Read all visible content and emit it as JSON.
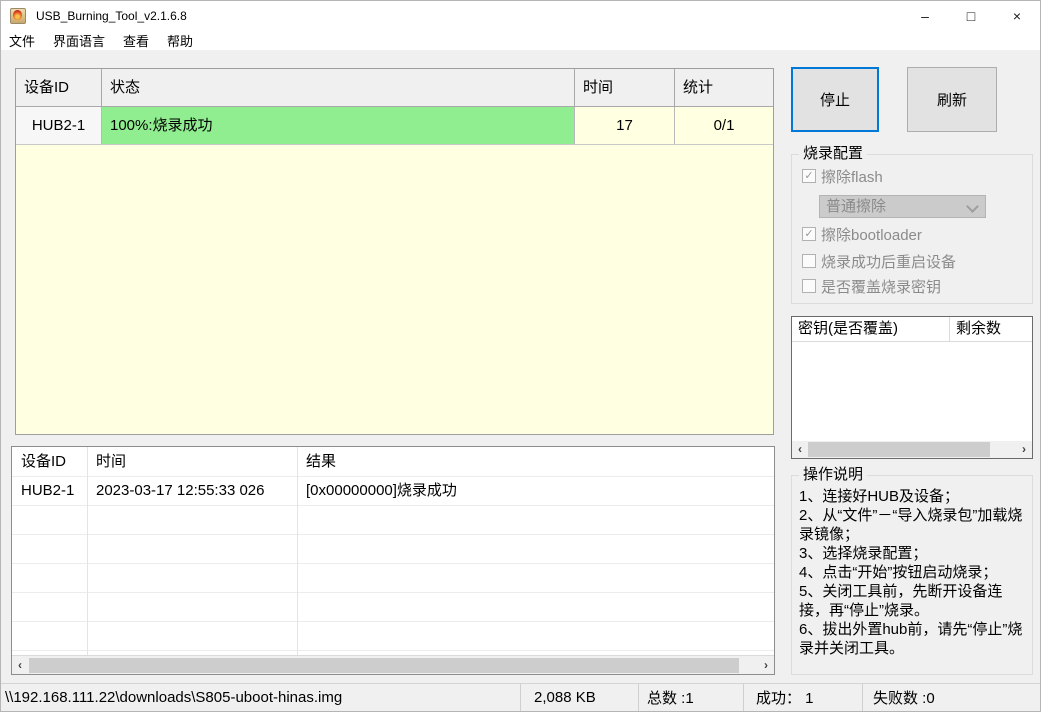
{
  "window": {
    "title": "USB_Burning_Tool_v2.1.6.8"
  },
  "icons": {
    "minimize": "–",
    "maximize": "□",
    "close": "×",
    "check": "✓",
    "scroll_left": "‹",
    "scroll_right": "›"
  },
  "menu": {
    "items": [
      "文件",
      "界面语言",
      "查看",
      "帮助"
    ]
  },
  "device_table": {
    "headers": [
      "设备ID",
      "状态",
      "时间",
      "统计"
    ],
    "row": {
      "id": "HUB2-1",
      "status": "100%:烧录成功",
      "time": "17",
      "stat": "0/1"
    }
  },
  "actions": {
    "stop": "停止",
    "refresh": "刷新"
  },
  "burn_config": {
    "title": "烧录配置",
    "erase_flash": "擦除flash",
    "erase_flash_checked": true,
    "erase_mode": "普通擦除",
    "erase_bootloader": "擦除bootloader",
    "erase_bootloader_checked": true,
    "reboot_after": "烧录成功后重启设备",
    "reboot_after_checked": false,
    "overwrite_key": "是否覆盖烧录密钥",
    "overwrite_key_checked": false
  },
  "key_table": {
    "headers": [
      "密钥(是否覆盖)",
      "剩余数"
    ],
    "rows": []
  },
  "instructions": {
    "title": "操作说明",
    "lines": [
      "1、连接好HUB及设备；",
      "2、从“文件”－“导入烧录包”加载烧录镜像；",
      "3、选择烧录配置；",
      "4、点击“开始”按钮启动烧录；",
      "5、关闭工具前，先断开设备连接，再“停止”烧录。",
      "6、拔出外置hub前，请先“停止”烧录并关闭工具。"
    ]
  },
  "log_table": {
    "headers": [
      "设备ID",
      "时间",
      "结果"
    ],
    "rows": [
      {
        "id": "HUB2-1",
        "time": "2023-03-17 12:55:33 026",
        "result": "[0x00000000]烧录成功"
      }
    ]
  },
  "status_bar": {
    "path": "\\\\192.168.111.22\\downloads\\S805-uboot-hinas.img",
    "size": "2,088 KB",
    "total": "总数 :1",
    "success": "成功： 1",
    "failed": "失败数 :0"
  },
  "colors": {
    "accent_blue": "#0078D7",
    "success_green": "#90EE90",
    "pending_yellow": "#FFFFE1",
    "window_bg": "#F0F0F0"
  }
}
